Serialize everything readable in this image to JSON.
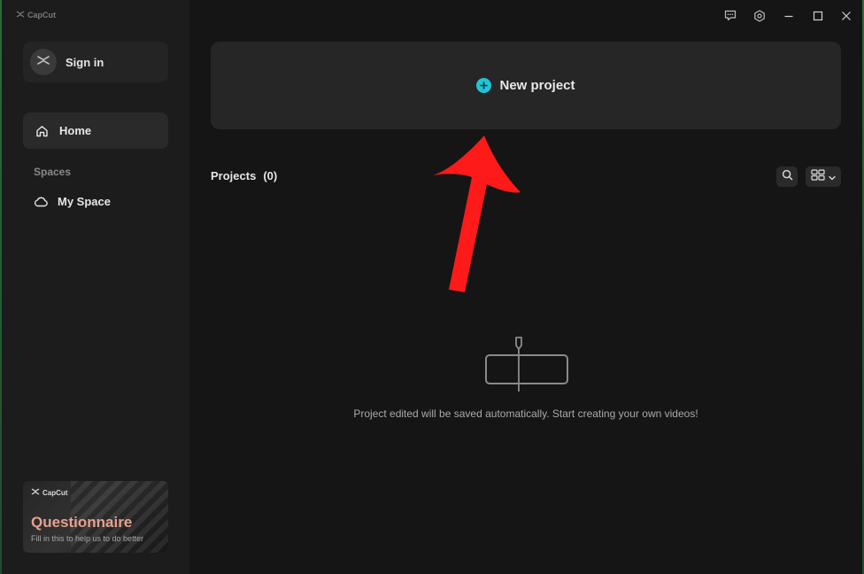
{
  "app": {
    "brand": "CapCut"
  },
  "sidebar": {
    "sign_in": "Sign in",
    "home": "Home",
    "spaces_heading": "Spaces",
    "my_space": "My Space",
    "promo": {
      "brand": "CapCut",
      "title": "Questionnaire",
      "subtitle": "Fill in this to help us to do better"
    }
  },
  "main": {
    "new_project": "New project",
    "projects_title": "Projects",
    "projects_count": "(0)",
    "empty_message": "Project edited will be saved automatically. Start creating your own videos!"
  },
  "colors": {
    "accent": "#1fc5d6",
    "annotation_arrow": "#ff1a1a",
    "promo_title": "#e8a090"
  },
  "icons": [
    "capcut-logo-icon",
    "home-icon",
    "cloud-icon",
    "feedback-icon",
    "settings-icon",
    "minimize-icon",
    "maximize-icon",
    "close-icon",
    "plus-icon",
    "search-icon",
    "grid-view-icon",
    "chevron-down-icon"
  ]
}
